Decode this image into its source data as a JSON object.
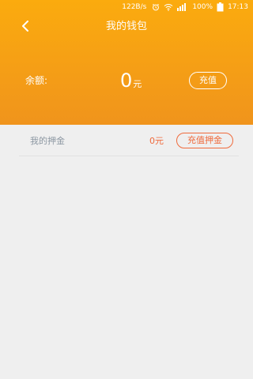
{
  "status_bar": {
    "network_speed": "122B/s",
    "battery_percent": "100%",
    "time": "17:13",
    "icons": [
      "alarm-icon",
      "wifi-icon",
      "signal-icon",
      "battery-icon"
    ]
  },
  "nav": {
    "back_icon": "chevron-left-icon",
    "title": "我的钱包"
  },
  "balance": {
    "label": "余额:",
    "value": "0",
    "unit": "元",
    "recharge_label": "充值"
  },
  "deposit": {
    "label": "我的押金",
    "amount": "0元",
    "recharge_label": "充值押金"
  },
  "colors": {
    "header_top": "#fbab0e",
    "header_bottom": "#f0941c",
    "background": "#efefef",
    "deposit_accent": "#ef6a3c",
    "deposit_label": "#8c97a2"
  }
}
